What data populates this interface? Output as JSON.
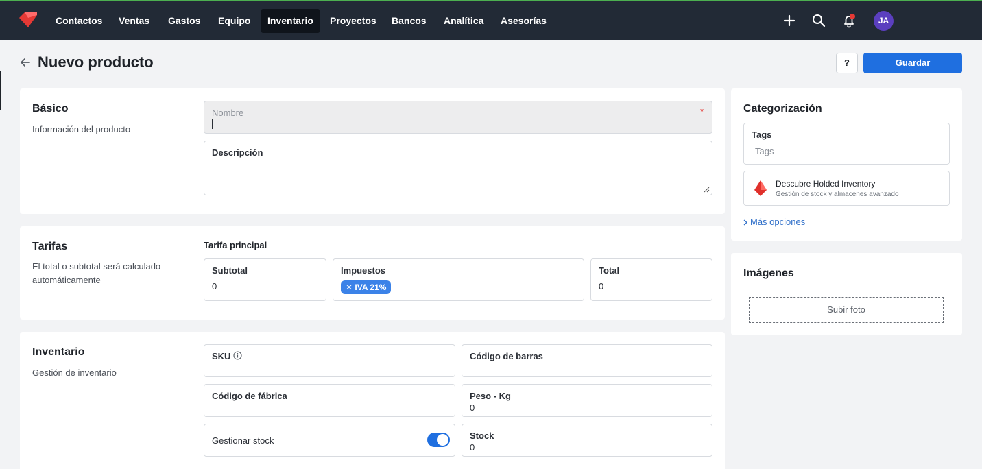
{
  "nav": {
    "items": [
      "Contactos",
      "Ventas",
      "Gastos",
      "Equipo",
      "Inventario",
      "Proyectos",
      "Bancos",
      "Analítica",
      "Asesorías"
    ],
    "active": "Inventario",
    "avatar_initials": "JA",
    "icons": [
      "plus-icon",
      "search-icon",
      "bell-icon"
    ]
  },
  "header": {
    "title": "Nuevo producto",
    "help_label": "?",
    "save_label": "Guardar"
  },
  "basico": {
    "title": "Básico",
    "desc": "Información del producto",
    "nombre_placeholder": "Nombre",
    "required_mark": "*",
    "descripcion_label": "Descripción"
  },
  "tarifas": {
    "title": "Tarifas",
    "desc": "El total o subtotal será calculado automáticamente",
    "section_label": "Tarifa principal",
    "subtotal_label": "Subtotal",
    "subtotal_value": "0",
    "impuestos_label": "Impuestos",
    "tax_tag": "✕ IVA 21%",
    "total_label": "Total",
    "total_value": "0"
  },
  "inventario": {
    "title": "Inventario",
    "desc": "Gestión de inventario",
    "sku_label": "SKU",
    "barcode_label": "Código de barras",
    "factory_code_label": "Código de fábrica",
    "weight_label": "Peso - Kg",
    "weight_value": "0",
    "manage_stock_label": "Gestionar stock",
    "manage_stock_on": true,
    "stock_label": "Stock",
    "stock_value": "0"
  },
  "categorizacion": {
    "title": "Categorización",
    "tags_label": "Tags",
    "tags_placeholder": "Tags",
    "promo_title": "Descubre Holded Inventory",
    "promo_subtitle": "Gestión de stock y almacenes avanzado",
    "more_options": "Más opciones"
  },
  "imagenes": {
    "title": "Imágenes",
    "upload_label": "Subir foto"
  },
  "colors": {
    "nav_bg": "#222a36",
    "accent": "#1f6fe0",
    "avatar": "#5b3fbf",
    "tag": "#3b82e8",
    "link": "#2f6fc9"
  }
}
